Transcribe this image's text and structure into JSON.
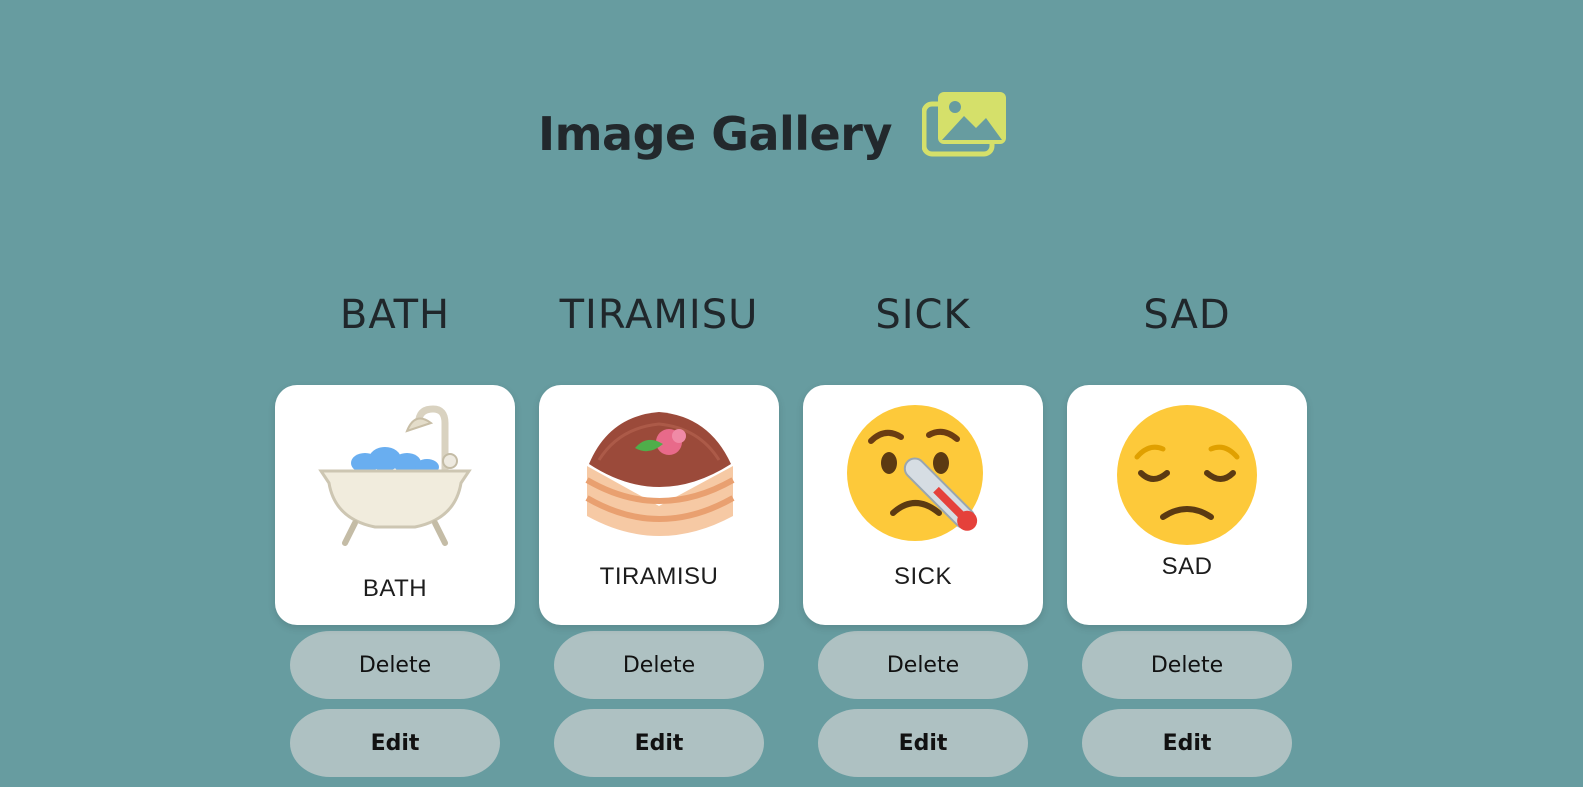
{
  "header": {
    "title": "Image Gallery",
    "icon": "image-gallery-icon",
    "icon_color": "#d5e06a"
  },
  "items": [
    {
      "heading": "BATH",
      "label": "BATH",
      "icon": "bathtub-icon",
      "delete_label": "Delete",
      "edit_label": "Edit"
    },
    {
      "heading": "TIRAMISU",
      "label": "TIRAMISU",
      "icon": "tiramisu-icon",
      "delete_label": "Delete",
      "edit_label": "Edit"
    },
    {
      "heading": "SICK",
      "label": "SICK",
      "icon": "sick-face-icon",
      "delete_label": "Delete",
      "edit_label": "Edit"
    },
    {
      "heading": "SAD",
      "label": "SAD",
      "icon": "sad-face-icon",
      "delete_label": "Delete",
      "edit_label": "Edit"
    }
  ],
  "colors": {
    "background": "#679ca0",
    "button": "#aec1c2",
    "card": "#ffffff"
  }
}
